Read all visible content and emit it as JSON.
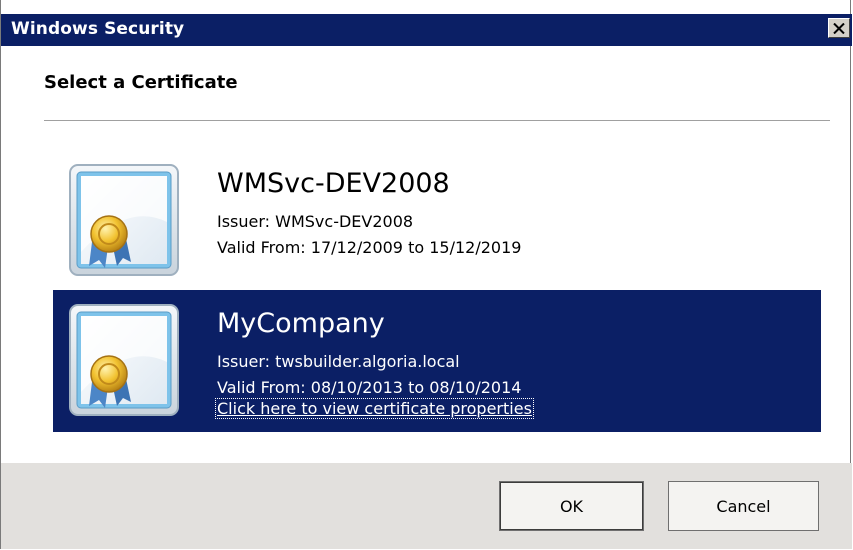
{
  "window": {
    "title": "Windows Security"
  },
  "header": {
    "title": "Select a Certificate"
  },
  "certificates": [
    {
      "name": "WMSvc-DEV2008",
      "issuer": "Issuer: WMSvc-DEV2008",
      "valid": "Valid From: 17/12/2009 to 15/12/2019",
      "selected": false
    },
    {
      "name": "MyCompany",
      "issuer": "Issuer: twsbuilder.algoria.local",
      "valid": "Valid From: 08/10/2013 to 08/10/2014",
      "link": "Click here to view certificate properties",
      "selected": true
    }
  ],
  "buttons": {
    "ok": "OK",
    "cancel": "Cancel"
  },
  "icons": {
    "close": "close-icon",
    "certificate": "certificate-icon"
  },
  "colors": {
    "titlebar": "#0b1f65",
    "selection": "#0b1f65",
    "footer": "#e2e0dd"
  }
}
